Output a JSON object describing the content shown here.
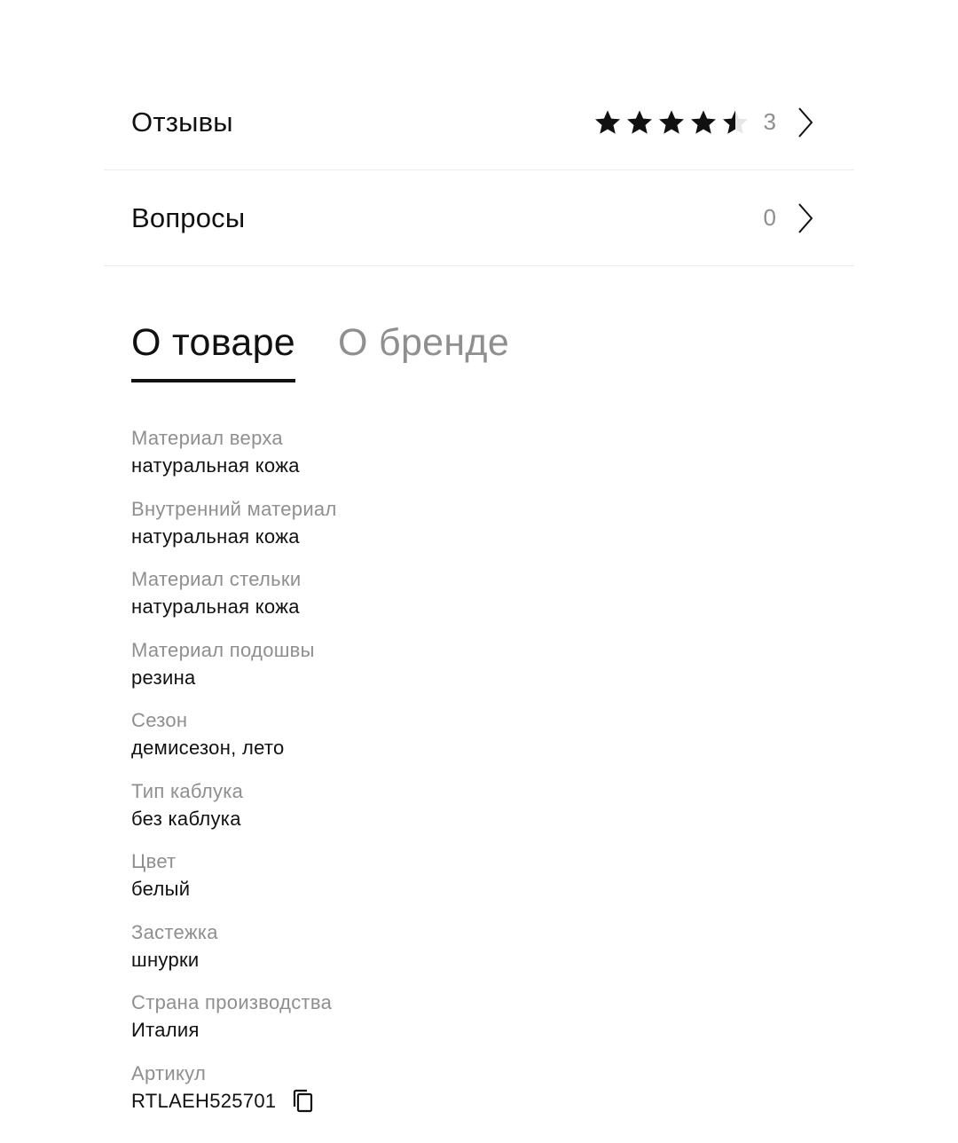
{
  "reviews": {
    "label": "Отзывы",
    "rating": 4.5,
    "count": "3"
  },
  "questions": {
    "label": "Вопросы",
    "count": "0"
  },
  "tabs": [
    {
      "label": "О товаре",
      "active": true
    },
    {
      "label": "О бренде",
      "active": false
    }
  ],
  "properties": [
    {
      "label": "Материал верха",
      "value": "натуральная кожа"
    },
    {
      "label": "Внутренний материал",
      "value": "натуральная кожа"
    },
    {
      "label": "Материал стельки",
      "value": "натуральная кожа"
    },
    {
      "label": "Материал подошвы",
      "value": "резина"
    },
    {
      "label": "Сезон",
      "value": "демисезон, лето"
    },
    {
      "label": "Тип каблука",
      "value": "без каблука"
    },
    {
      "label": "Цвет",
      "value": "белый"
    },
    {
      "label": "Застежка",
      "value": "шнурки"
    },
    {
      "label": "Страна производства",
      "value": "Италия"
    },
    {
      "label": "Артикул",
      "value": "RTLAEH525701"
    }
  ],
  "icons": {
    "star": "star-icon",
    "chevron": "chevron-right-icon",
    "copy": "copy-icon"
  },
  "colors": {
    "text": "#111111",
    "muted": "#8f8f8f",
    "divider": "#ececec",
    "star_filled": "#111111",
    "star_empty": "#e6e6e6"
  }
}
